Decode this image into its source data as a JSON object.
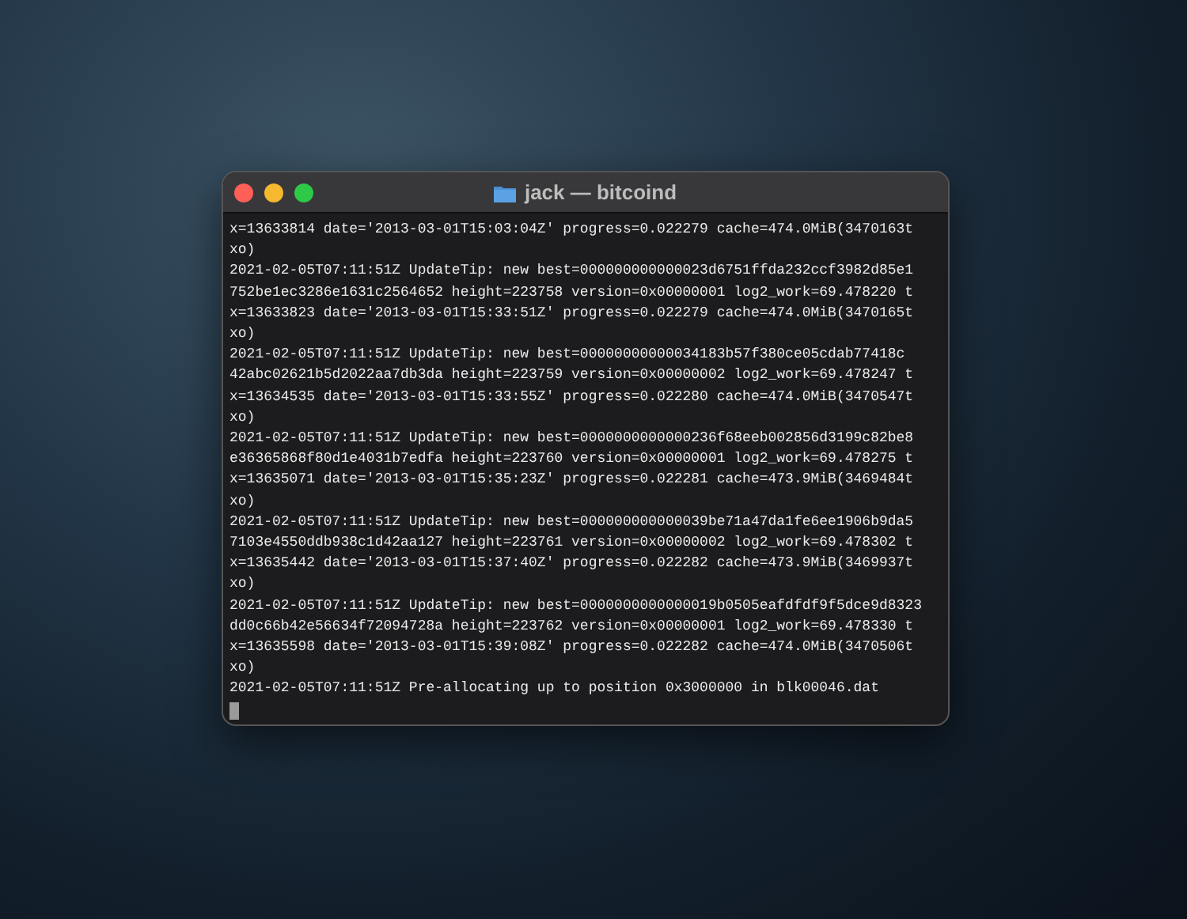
{
  "window": {
    "title": "jack — bitcoind"
  },
  "terminal": {
    "lines": [
      "x=13633814 date='2013-03-01T15:03:04Z' progress=0.022279 cache=474.0MiB(3470163t",
      "xo)",
      "2021-02-05T07:11:51Z UpdateTip: new best=000000000000023d6751ffda232ccf3982d85e1",
      "752be1ec3286e1631c2564652 height=223758 version=0x00000001 log2_work=69.478220 t",
      "x=13633823 date='2013-03-01T15:33:51Z' progress=0.022279 cache=474.0MiB(3470165t",
      "xo)",
      "2021-02-05T07:11:51Z UpdateTip: new best=00000000000034183b57f380ce05cdab77418c",
      "42abc02621b5d2022aa7db3da height=223759 version=0x00000002 log2_work=69.478247 t",
      "x=13634535 date='2013-03-01T15:33:55Z' progress=0.022280 cache=474.0MiB(3470547t",
      "xo)",
      "2021-02-05T07:11:51Z UpdateTip: new best=0000000000000236f68eeb002856d3199c82be8",
      "e36365868f80d1e4031b7edfa height=223760 version=0x00000001 log2_work=69.478275 t",
      "x=13635071 date='2013-03-01T15:35:23Z' progress=0.022281 cache=473.9MiB(3469484t",
      "xo)",
      "2021-02-05T07:11:51Z UpdateTip: new best=000000000000039be71a47da1fe6ee1906b9da5",
      "7103e4550ddb938c1d42aa127 height=223761 version=0x00000002 log2_work=69.478302 t",
      "x=13635442 date='2013-03-01T15:37:40Z' progress=0.022282 cache=473.9MiB(3469937t",
      "xo)",
      "2021-02-05T07:11:51Z UpdateTip: new best=0000000000000019b0505eafdfdf9f5dce9d8323",
      "dd0c66b42e56634f72094728a height=223762 version=0x00000001 log2_work=69.478330 t",
      "x=13635598 date='2013-03-01T15:39:08Z' progress=0.022282 cache=474.0MiB(3470506t",
      "xo)",
      "2021-02-05T07:11:51Z Pre-allocating up to position 0x3000000 in blk00046.dat"
    ]
  }
}
